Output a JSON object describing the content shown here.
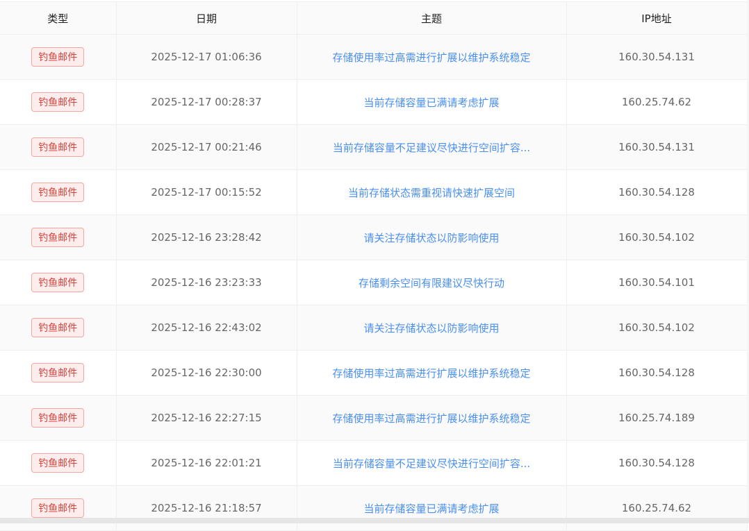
{
  "columns": [
    "类型",
    "日期",
    "主题",
    "IP地址"
  ],
  "rows": [
    {
      "type": "钓鱼邮件",
      "date": "2025-12-17 01:06:36",
      "subject": "存储使用率过高需进行扩展以维护系统稳定",
      "ip": "160.30.54.131"
    },
    {
      "type": "钓鱼邮件",
      "date": "2025-12-17 00:28:37",
      "subject": "当前存储容量已满请考虑扩展",
      "ip": "160.25.74.62"
    },
    {
      "type": "钓鱼邮件",
      "date": "2025-12-17 00:21:46",
      "subject": "当前存储容量不足建议尽快进行空间扩容...",
      "ip": "160.30.54.131"
    },
    {
      "type": "钓鱼邮件",
      "date": "2025-12-17 00:15:52",
      "subject": "当前存储状态需重视请快速扩展空间",
      "ip": "160.30.54.128"
    },
    {
      "type": "钓鱼邮件",
      "date": "2025-12-16 23:28:42",
      "subject": "请关注存储状态以防影响使用",
      "ip": "160.30.54.102"
    },
    {
      "type": "钓鱼邮件",
      "date": "2025-12-16 23:23:33",
      "subject": "存储剩余空间有限建议尽快行动",
      "ip": "160.30.54.101"
    },
    {
      "type": "钓鱼邮件",
      "date": "2025-12-16 22:43:02",
      "subject": "请关注存储状态以防影响使用",
      "ip": "160.30.54.102"
    },
    {
      "type": "钓鱼邮件",
      "date": "2025-12-16 22:30:00",
      "subject": "存储使用率过高需进行扩展以维护系统稳定",
      "ip": "160.30.54.128"
    },
    {
      "type": "钓鱼邮件",
      "date": "2025-12-16 22:27:15",
      "subject": "存储使用率过高需进行扩展以维护系统稳定",
      "ip": "160.25.74.189"
    },
    {
      "type": "钓鱼邮件",
      "date": "2025-12-16 22:01:21",
      "subject": "当前存储容量不足建议尽快进行空间扩容...",
      "ip": "160.30.54.128"
    },
    {
      "type": "钓鱼邮件",
      "date": "2025-12-16 21:18:57",
      "subject": "当前存储容量已满请考虑扩展",
      "ip": "160.25.74.62"
    }
  ]
}
